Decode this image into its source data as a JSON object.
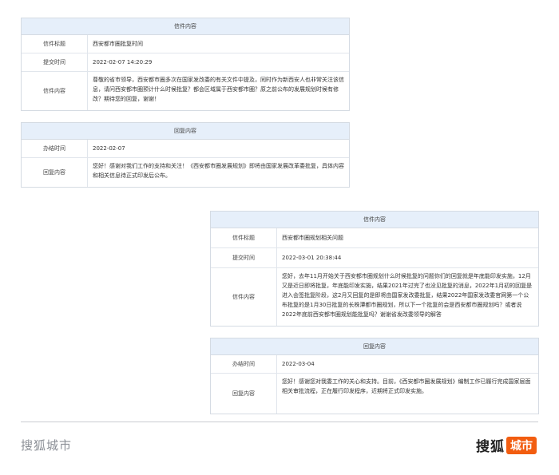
{
  "panel1": {
    "header": "信件内容",
    "rows": [
      {
        "label": "信件标题",
        "value": "西安都市圈批复时间"
      },
      {
        "label": "提交时间",
        "value": "2022-02-07 14:20:29"
      },
      {
        "label": "信件内容",
        "value": "尊敬的省市领导，西安都市圈多次在国家发改委的有关文件中提及，同时作为新西安人也非常关注该信息，请问西安都市圈预计什么时候批复？都会区域属于西安都市圈？原之前公布的发展规划时候有修改？期待您的回复，谢谢！"
      }
    ]
  },
  "panel2": {
    "header": "回复内容",
    "rows": [
      {
        "label": "办结时间",
        "value": "2022-02-07"
      },
      {
        "label": "回复内容",
        "value": "您好！感谢对我们工作的支持和关注！《西安都市圈发展规划》即将由国家发展改革委批复，具体内容和相关信息待正式印发后公布。"
      }
    ]
  },
  "panel3": {
    "header": "信件内容",
    "rows": [
      {
        "label": "信件标题",
        "value": "西安都市圈规划相关问题"
      },
      {
        "label": "提交时间",
        "value": "2022-03-01 20:38:44"
      },
      {
        "label": "信件内容",
        "value": "您好，去年11月开始关于西安都市圈规划什么时候批复的问题你们的回复就是年底能印发实施，12月又是近日即将批复，年底能印发实施，结果2021年过完了也没见批复的消息，2022年1月初的回复是进入会签批复阶段，这2月又回复的是即将由国家发改委批复，结果2022年国家发改委官网第一个公布批复的是1月30日批复的长株潭都市圈规划，所以下一个批复的会是西安都市圈规划吗？或者说2022年底前西安都市圈规划能批复吗？谢谢省发改委领导的解答"
      }
    ]
  },
  "panel4": {
    "header": "回复内容",
    "rows": [
      {
        "label": "办结时间",
        "value": "2022-03-04"
      },
      {
        "label": "回复内容",
        "value": "您好！感谢您对我委工作的关心和支持。目前，《西安都市圈发展规划》编制工作已履行完成国家层面相关审批流程，正在履行印发程序，近期将正式印发实施。"
      }
    ]
  },
  "footer": {
    "left_brand": "搜狐城市",
    "right_brand_main": "搜狐",
    "right_brand_tag": "城市"
  }
}
